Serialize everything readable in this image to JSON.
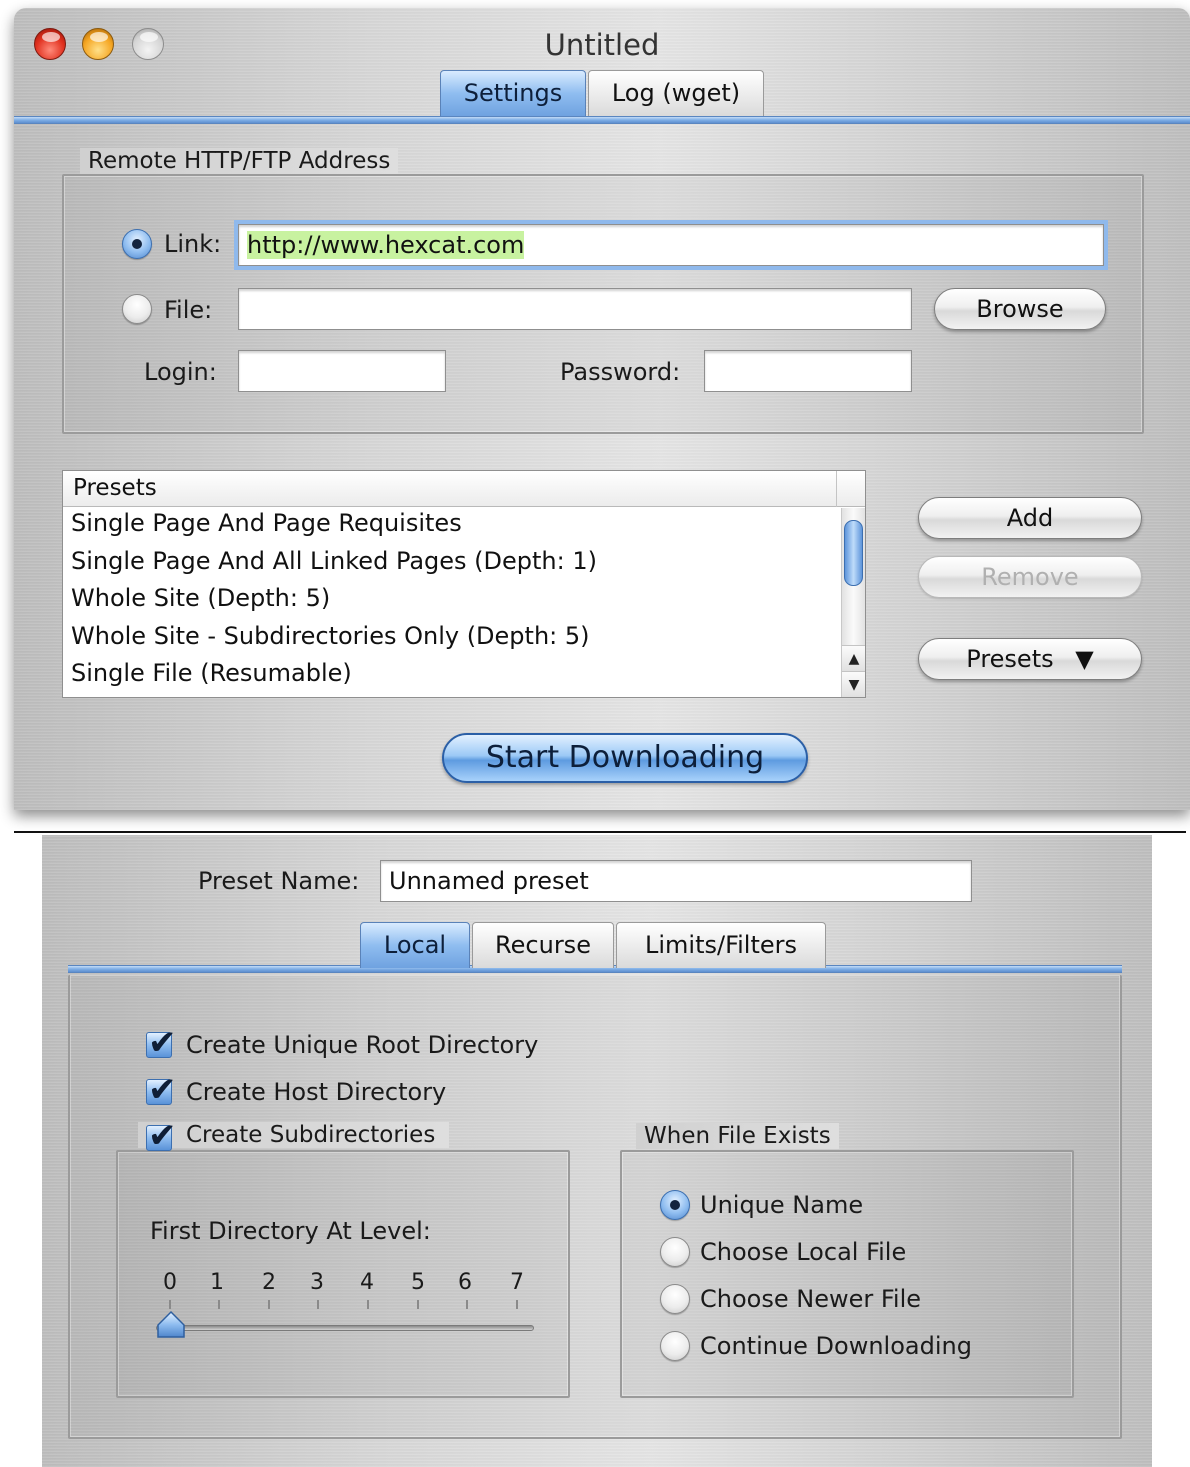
{
  "window": {
    "title": "Untitled",
    "tabs": [
      "Settings",
      "Log (wget)"
    ],
    "active_tab": "Settings"
  },
  "remote": {
    "group_label": "Remote HTTP/FTP Address",
    "link_label": "Link:",
    "link_value": "http://www.hexcat.com",
    "link_selected": true,
    "file_label": "File:",
    "file_value": "",
    "browse_label": "Browse",
    "login_label": "Login:",
    "login_value": "",
    "password_label": "Password:",
    "password_value": ""
  },
  "presets": {
    "header": "Presets",
    "items": [
      "Single Page And Page Requisites",
      "Single Page And All Linked Pages (Depth: 1)",
      "Whole Site (Depth: 5)",
      "Whole Site - Subdirectories Only (Depth: 5)",
      "Single File (Resumable)"
    ],
    "add_label": "Add",
    "remove_label": "Remove",
    "presets_menu_label": "Presets",
    "presets_menu_arrow": "▼"
  },
  "start_label": "Start Downloading",
  "preset_editor": {
    "name_label": "Preset Name:",
    "name_value": "Unnamed preset",
    "tabs": [
      "Local",
      "Recurse",
      "Limits/Filters"
    ],
    "active_tab": "Local",
    "checkboxes": [
      {
        "label": "Create Unique Root Directory",
        "checked": true
      },
      {
        "label": "Create Host Directory",
        "checked": true
      },
      {
        "label": "Create Subdirectories",
        "checked": true
      }
    ],
    "first_dir_label": "First Directory At Level:",
    "levels": [
      "0",
      "1",
      "2",
      "3",
      "4",
      "5",
      "6",
      "7"
    ],
    "level_value": 0,
    "file_exists": {
      "group_label": "When File Exists",
      "options": [
        "Unique Name",
        "Choose Local File",
        "Choose Newer File",
        "Continue Downloading"
      ],
      "selected": "Unique Name"
    }
  },
  "colors": {
    "accent_blue": "#6fa2e0",
    "link_highlight": "#c8f2a0",
    "close_red": "#e0301e",
    "minimize_yellow": "#f5a623"
  }
}
